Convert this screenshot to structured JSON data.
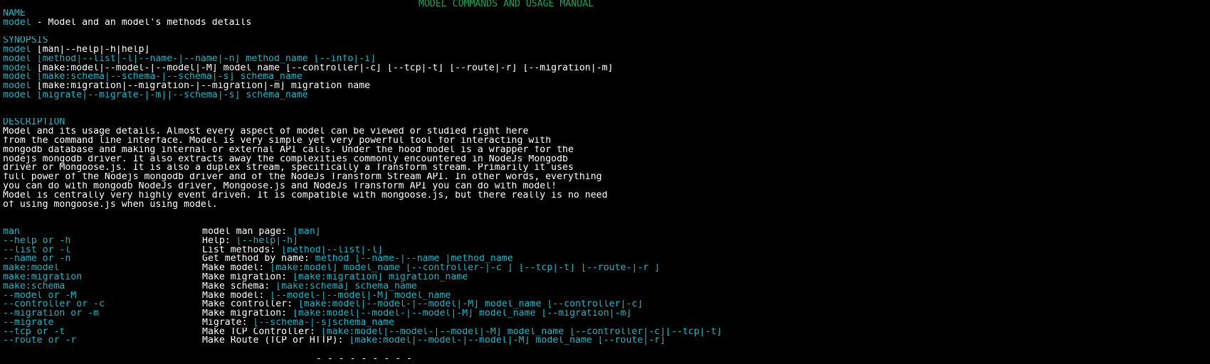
{
  "banner": "MODEL COMMANDS AND USAGE MANUAL",
  "name": {
    "heading": "NAME",
    "line_cmd": "model",
    "line_rest": " - Model and an model's methods details"
  },
  "synopsis": {
    "heading": "SYNOPSIS",
    "lines": [
      {
        "cmd": "model",
        "rest": " [man|--help|-h|help]",
        "style": "white"
      },
      {
        "cmd": "model",
        "rest": " [method|--list|-l|--name-|--name|-n] method_name [--info|-i]",
        "style": "cyan"
      },
      {
        "cmd": "model",
        "rest": " [make:model|--model-|--model|-M] model name [--controller|-c] [--tcp|-t] [--route|-r] [--migration|-m]",
        "style": "white"
      },
      {
        "cmd": "model",
        "rest": " [make:schema|--schema-|--schema|-s] schema_name",
        "style": "cyan"
      },
      {
        "cmd": "model",
        "rest": " [make:migration|--migration-|--migration|-m] migration name",
        "style": "white"
      },
      {
        "cmd": "model",
        "rest": " [migrate|--migrate-|-m||--schema|-s] schema_name",
        "style": "cyan"
      }
    ]
  },
  "description": {
    "heading": "DESCRIPTION",
    "lines": [
      "Model and its usage details. Almost every aspect of model can be viewed or studied right here",
      "from the command line interface. Model is very simple yet very powerful tool for interacting with",
      "mongodb database and making internal or external API calls. Under the hood model is a wrapper for the",
      "nodejs mongodb driver. It also extracts away the complexities commonly encountered in NodeJs Mongodb",
      "driver or Mongoose.js. It is also a duplex stream, specifically a Transform stream. Primarily it uses",
      "full power of the Nodejs mongodb driver and of the NodeJs Transform Stream API. In other words, everything",
      "you can do with mongodb NodeJs driver, Mongoose.js and NodeJs Transform API you can do with model!",
      "Model is centrally very highly event driven. It is compatible with mongoose.js, but there really is no need",
      "of using mongoose.js when using model."
    ]
  },
  "options": [
    {
      "opt": "man",
      "label": "model man page: ",
      "usage": "[man]"
    },
    {
      "opt": "--help or -h",
      "label": "Help: ",
      "usage": "[--help|-h]"
    },
    {
      "opt": "--list or -l",
      "label": "List methods: ",
      "usage": "[method|--list|-l]"
    },
    {
      "opt": "--name or -n",
      "label": "Get method by name: ",
      "usage": "method [--name-|--name |method_name"
    },
    {
      "opt": "make:model",
      "label": "Make model: ",
      "usage": "[make:model] model_name [--controller-|-c ] [--tcp|-t] [--route-|-r ]"
    },
    {
      "opt": "make:migration",
      "label": "Make migration: ",
      "usage": "[make:migration] migration_name"
    },
    {
      "opt": "make:schema",
      "label": "Make schema: ",
      "usage": "[make:schema] schema_name"
    },
    {
      "opt": "--model or -M",
      "label": "Make model: ",
      "usage": "[--model-|--model|-M] model_name"
    },
    {
      "opt": "--controller or -c",
      "label": "Make controller: ",
      "usage": "[make:model|--model-|--model|-M] model_name [--controller|-c]"
    },
    {
      "opt": "--migration or -m",
      "label": "Make migration: ",
      "usage": "[make:model|--model-|--model|-M] model_name [--migration|-m]"
    },
    {
      "opt": "--migrate",
      "label": "Migrate: ",
      "usage": "[--schema-|-s]schema_name"
    },
    {
      "opt": "--tcp or -t",
      "label": "Make TCP Controller: ",
      "usage": "[make:model|--model-|--model|-M] model_name [--controller|-c][--tcp|-t]"
    },
    {
      "opt": "--route or -r",
      "label": "Make Route (TCP or HTTP): ",
      "usage": "[make:model|--model-|--model|-M] model_name [--route|-r]"
    }
  ],
  "footer": "- - - - - - - - -",
  "colors": {
    "background": "#000000",
    "text": "#ffffff",
    "cyan": "#1fb5c7",
    "banner_green": "#22a35a"
  }
}
